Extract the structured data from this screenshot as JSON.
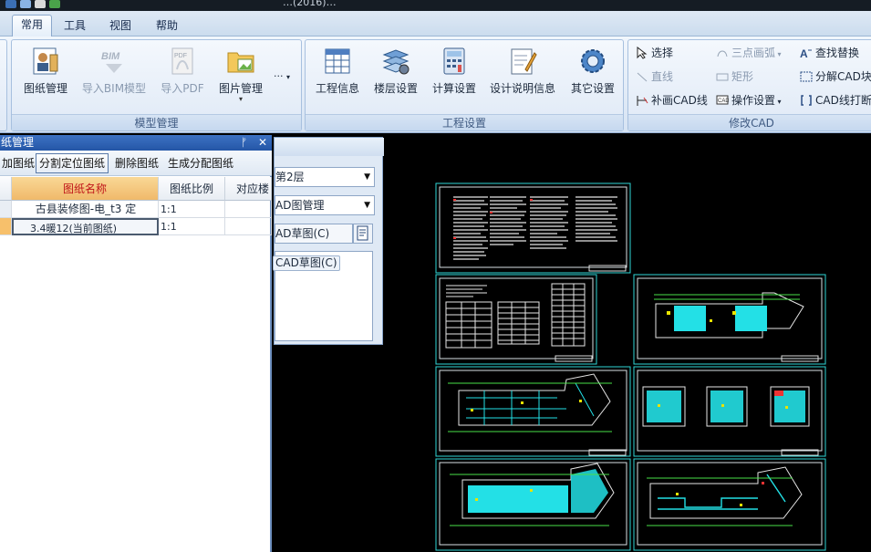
{
  "titlebar": {
    "title": "…(2016)…"
  },
  "tabs": [
    {
      "label": "常用",
      "active": true
    },
    {
      "label": "工具",
      "active": false
    },
    {
      "label": "视图",
      "active": false
    },
    {
      "label": "帮助",
      "active": false
    }
  ],
  "ribbon": {
    "model_group": {
      "label": "模型管理",
      "buttons": [
        {
          "label": "图纸管理",
          "icon": "drawing-manager-icon",
          "enabled": true
        },
        {
          "label": "导入BIM模型",
          "icon": "bim-import-icon",
          "enabled": false
        },
        {
          "label": "导入PDF",
          "icon": "pdf-import-icon",
          "enabled": false
        },
        {
          "label": "图片管理",
          "icon": "image-folder-icon",
          "enabled": true
        }
      ],
      "more": "···"
    },
    "project_group": {
      "label": "工程设置",
      "buttons": [
        {
          "label": "工程信息",
          "icon": "project-info-icon"
        },
        {
          "label": "楼层设置",
          "icon": "floor-settings-icon"
        },
        {
          "label": "计算设置",
          "icon": "calculator-icon"
        },
        {
          "label": "设计说明信息",
          "icon": "design-notes-icon"
        },
        {
          "label": "其它设置",
          "icon": "gear-icon"
        }
      ]
    },
    "cad_group": {
      "label": "修改CAD",
      "col1": [
        {
          "label": "选择",
          "enabled": true
        },
        {
          "label": "直线",
          "enabled": false
        },
        {
          "label": "补画CAD线",
          "enabled": true
        }
      ],
      "col2": [
        {
          "label": "三点画弧",
          "enabled": false
        },
        {
          "label": "矩形",
          "enabled": false
        },
        {
          "label": "操作设置",
          "enabled": true
        }
      ],
      "col3": [
        {
          "label": "查找替换",
          "enabled": true
        },
        {
          "label": "分解CAD块",
          "enabled": true
        },
        {
          "label": "CAD线打断",
          "enabled": true
        }
      ]
    }
  },
  "drawing_panel": {
    "title": "纸管理",
    "pin": "📌",
    "close": "✕",
    "toolbar": [
      "加图纸",
      "分割定位图纸",
      "删除图纸",
      "生成分配图纸"
    ],
    "columns": [
      "图纸名称",
      "图纸比例",
      "对应楼"
    ],
    "rows": [
      {
        "name": "古县装修图-电_t3 定",
        "scale": "1:1",
        "floor": ""
      },
      {
        "name": "3.4暖12(当前图纸)",
        "scale": "1:1",
        "floor": ""
      }
    ]
  },
  "mid_panel": {
    "floor_value": "第2层",
    "cad_manager": "AD图管理",
    "cad_sketch": "AD草图(C)",
    "cad_sketch_item": "CAD草图(C)"
  },
  "colors": {
    "accent": "#2456a6",
    "selected_row": "#f7c06b",
    "canvas": "#000000",
    "cad_border": "#2fd6d6",
    "cad_fill": "#23e0e6"
  }
}
